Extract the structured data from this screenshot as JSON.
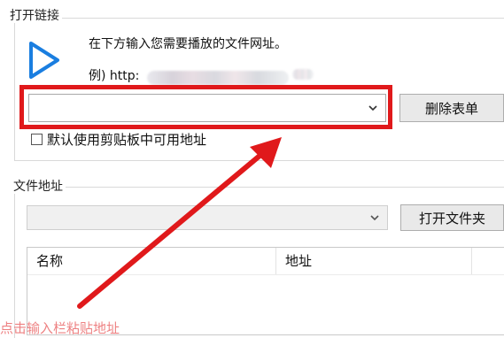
{
  "open_link": {
    "group_title": "打开链接",
    "prompt": "在下方输入您需要播放的文件网址。",
    "example_prefix": "例) http:",
    "url_combo_value": "",
    "delete_button": "删除表单",
    "checkbox_label": "默认使用剪贴板中可用地址",
    "checkbox_checked": false
  },
  "file_address": {
    "group_title": "文件地址",
    "combo_value": "",
    "open_folder_button": "打开文件夹",
    "columns": [
      "名称",
      "地址"
    ]
  },
  "annotation": {
    "color": "#e0191b",
    "bottom_note": "点击输入栏粘贴地址"
  },
  "icons": {
    "play": "play-triangle-icon",
    "dropdown": "chevron-down-icon"
  }
}
